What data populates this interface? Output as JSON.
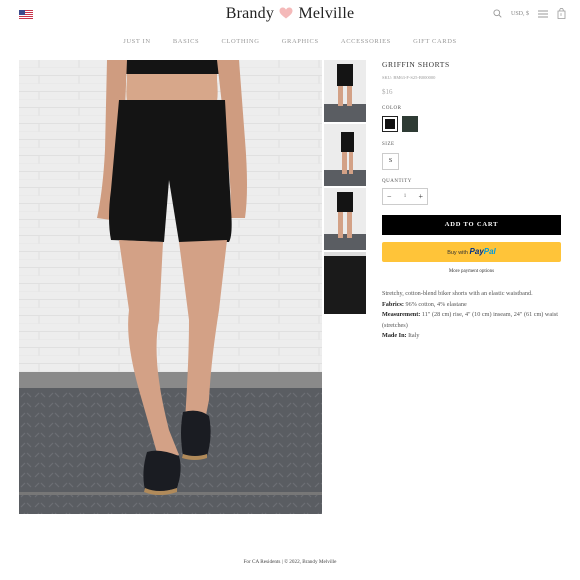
{
  "header": {
    "flag_icon": "us-flag-icon",
    "logo_left": "Brandy",
    "logo_right": "Melville",
    "currency": "USD, $",
    "cart_count": "0"
  },
  "nav": {
    "items": [
      "JUST IN",
      "BASICS",
      "CLOTHING",
      "GRAPHICS",
      "ACCESSORIES",
      "GIFT CARDS"
    ]
  },
  "product": {
    "title": "GRIFFIN SHORTS",
    "sku": "SKU: BM63-F-S25-B000000",
    "price": "$16",
    "color_label": "COLOR",
    "colors": [
      "#111111",
      "#2e3b34"
    ],
    "size_label": "SIZE",
    "size": "S",
    "quantity_label": "QUANTITY",
    "quantity": "1",
    "add_to_cart": "ADD TO CART",
    "paypal_prefix": "Buy with",
    "paypal_brand_1": "Pay",
    "paypal_brand_2": "Pal",
    "more_payment": "More payment options",
    "description": "Stretchy, cotton-blend biker shorts with an elastic waistband.",
    "fabrics_label": "Fabrics:",
    "fabrics": "96% cotton, 4% elastane",
    "measurement_label": "Measurement:",
    "measurement": "11\" (28 cm) rise, 4\" (10 cm) inseam, 24\" (61 cm) waist (stretches)",
    "made_in_label": "Made In:",
    "made_in": "Italy"
  },
  "footer": {
    "text": "For CA Residents | © 2022, Brandy Melville"
  }
}
